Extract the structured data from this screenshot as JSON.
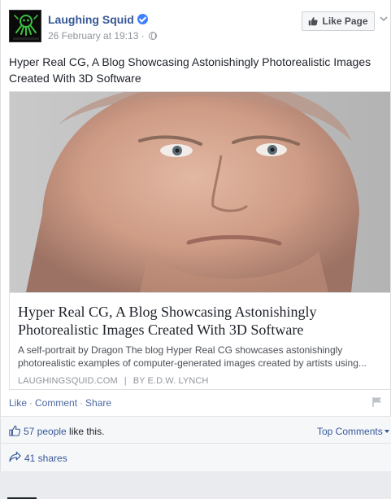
{
  "post": {
    "page_name": "Laughing Squid",
    "timestamp": "26 February at 19:13",
    "meta_sep": " · ",
    "like_page_label": "Like Page",
    "text": "Hyper Real CG, A Blog Showcasing Astonishingly Photorealistic Images Created With 3D Software",
    "avatar_caption": "LAUGHING SQUID"
  },
  "link_preview": {
    "title": "Hyper Real CG, A Blog Showcasing Astonishingly Photorealistic Images Created With 3D Software",
    "description": "A self-portrait by Dragon The blog Hyper Real CG showcases astonishingly photorealistic examples of computer-generated images created by artists using...",
    "domain": "LAUGHINGSQUID.COM",
    "source_sep": "|",
    "author": "BY E.D.W. LYNCH"
  },
  "actions": {
    "like": "Like",
    "comment": "Comment",
    "share": "Share",
    "dot": "·"
  },
  "feedback": {
    "likes_count_link": "57 people",
    "likes_suffix": " like this.",
    "top_comments": "Top Comments",
    "shares": "41 shares"
  },
  "colors": {
    "link_blue": "#365899",
    "verified_blue": "#4080ff",
    "avatar_green": "#3fbf3f"
  },
  "icons": [
    "verified-icon",
    "globe-icon",
    "thumbs-up-icon",
    "chevron-down-icon",
    "flag-icon",
    "share-arrow-icon"
  ]
}
